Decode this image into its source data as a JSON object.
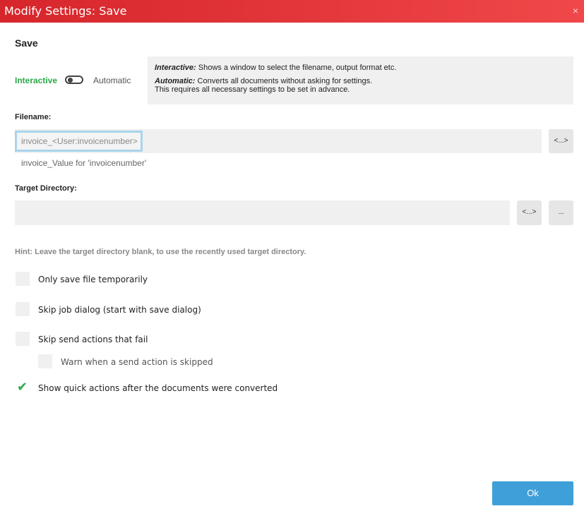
{
  "window": {
    "title": "Modify Settings: Save",
    "close_glyph": "×"
  },
  "section": {
    "title": "Save"
  },
  "mode": {
    "interactive_label": "Interactive",
    "automatic_label": "Automatic",
    "selected": "Interactive"
  },
  "info": {
    "interactive_term": "Interactive:",
    "interactive_desc": "Shows a window to select the filename, output format etc.",
    "automatic_term": "Automatic:",
    "automatic_desc": "Converts all documents without asking for settings.",
    "automatic_desc2": "This requires all necessary settings to be set in advance."
  },
  "filename": {
    "label": "Filename:",
    "token_value": "invoice_<User:invoicenumber>",
    "token_button": "<...>",
    "preview": "invoice_Value for 'invoicenumber'"
  },
  "target": {
    "label": "Target Directory:",
    "value": "",
    "token_button": "<...>",
    "browse_button": "..."
  },
  "hint": "Hint: Leave the target directory blank, to use the recently used target directory.",
  "options": {
    "only_temp": {
      "label": "Only save file temporarily",
      "checked": false
    },
    "skip_job_dialog": {
      "label": "Skip job dialog (start with save dialog)",
      "checked": false
    },
    "skip_send_fail": {
      "label": "Skip send actions that fail",
      "checked": false
    },
    "warn_skipped": {
      "label": "Warn when a send action is skipped",
      "checked": false
    },
    "show_quick_actions": {
      "label": "Show quick actions after the documents were converted",
      "checked": true,
      "mark": "✔"
    }
  },
  "footer": {
    "ok_label": "Ok"
  },
  "colors": {
    "title_bar": "#e2363a",
    "accent_green": "#2aa84a",
    "ok_button": "#3fa0d9",
    "focus_border": "#a9d4ec"
  },
  "icons": {
    "close": "close-icon",
    "toggle": "toggle-switch-icon",
    "checkmark": "checkmark-icon"
  }
}
